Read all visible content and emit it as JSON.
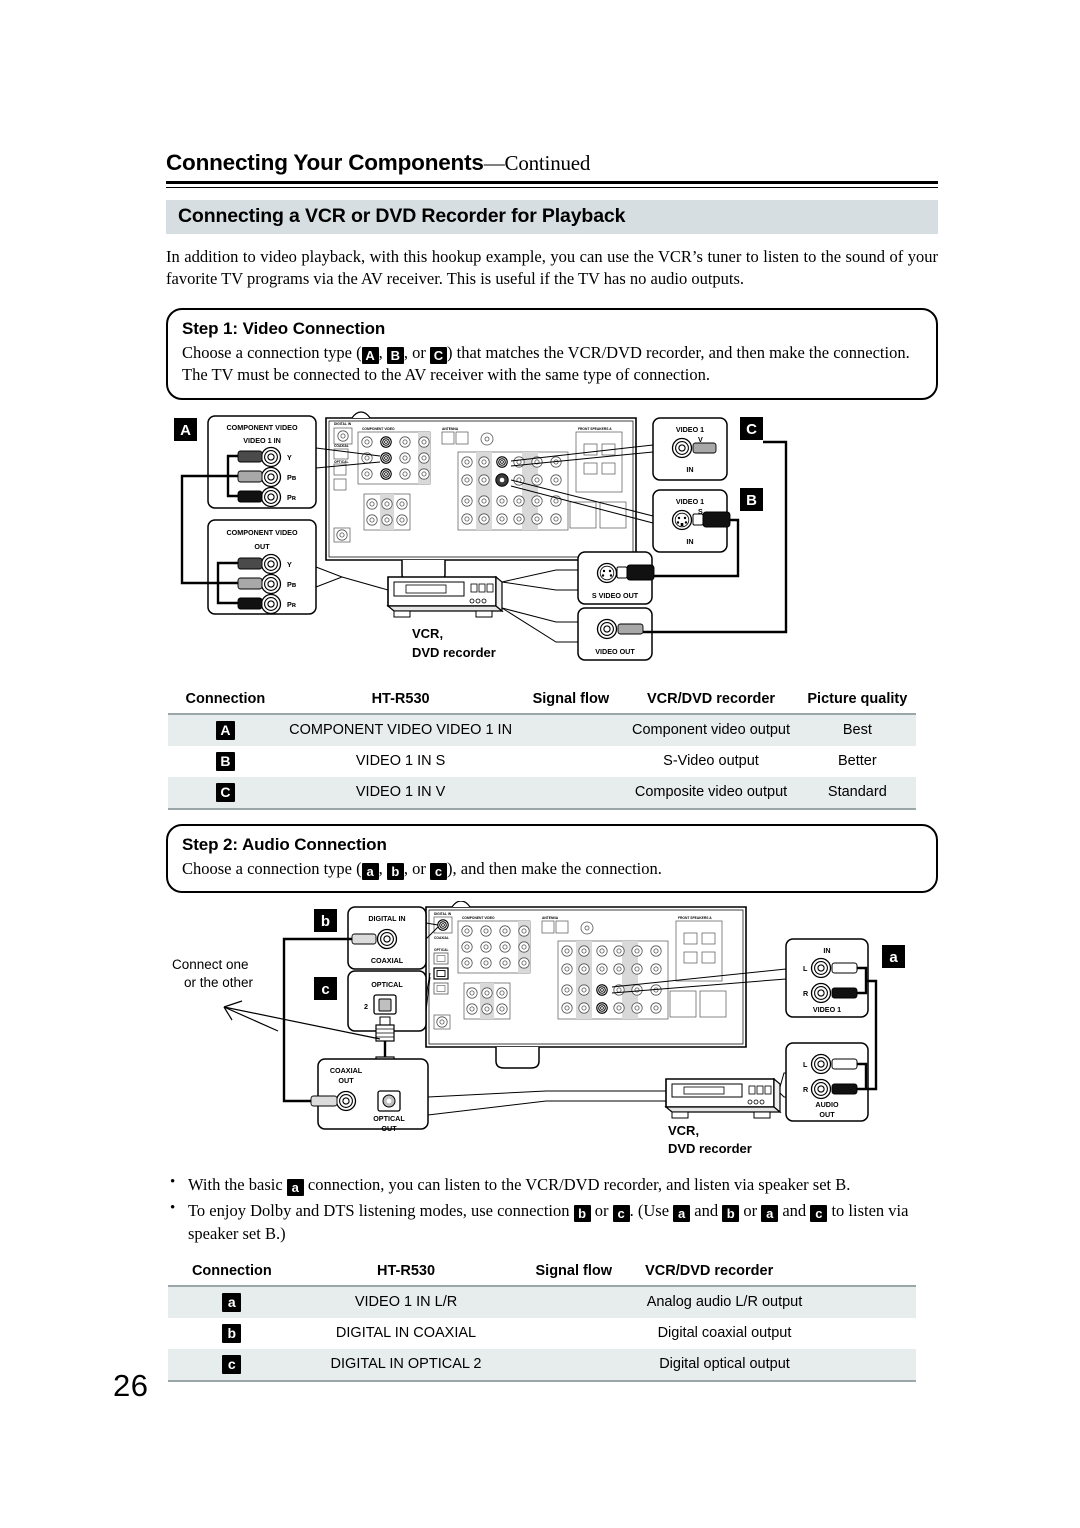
{
  "page": {
    "number": "26",
    "running_head": "Connecting Your Components",
    "running_head_suffix": "—Continued",
    "section_title": "Connecting a VCR or DVD Recorder for Playback",
    "intro": "In addition to video playback, with this hookup example, you can use the VCR’s tuner to listen to the sound of your favorite TV programs via the AV receiver. This is useful if the TV has no audio outputs."
  },
  "step1": {
    "title": "Step 1: Video Connection",
    "text_a": "Choose a connection type (",
    "badge_a": "A",
    "sep1": ", ",
    "badge_b": "B",
    "sep2": ", or ",
    "badge_c": "C",
    "text_b": ") that matches the VCR/DVD recorder, and then make the connection. The TV must be connected to the AV receiver with the same type of connection."
  },
  "step2": {
    "title": "Step 2: Audio Connection",
    "text_a": "Choose a connection type (",
    "badge_a": "a",
    "sep1": ", ",
    "badge_b": "b",
    "sep2": ", or ",
    "badge_c": "c",
    "text_b": "), and then make the connection."
  },
  "video_diagram": {
    "badge_a": "A",
    "badge_b": "B",
    "badge_c": "C",
    "receiver_component_panel": {
      "heading": "COMPONENT VIDEO",
      "sub": "VIDEO 1 IN",
      "jacks": [
        "Y",
        "Pʙ",
        "Pʀ"
      ]
    },
    "vcr_component_panel": {
      "heading": "COMPONENT VIDEO",
      "sub": "OUT",
      "jacks": [
        "Y",
        "Pʙ",
        "Pʀ"
      ]
    },
    "video1_v_panel": {
      "top": "VIDEO 1",
      "jack": "V",
      "bottom": "IN"
    },
    "video1_s_panel": {
      "top": "VIDEO 1",
      "jack": "S",
      "bottom": "IN"
    },
    "s_video_out_panel": {
      "label": "S VIDEO OUT"
    },
    "video_out_panel": {
      "label": "VIDEO OUT"
    },
    "device_label_line1": "VCR,",
    "device_label_line2": "DVD recorder",
    "receiver_panel_texts": {
      "component_video": "COMPONENT VIDEO",
      "antenna": "ANTENNA",
      "front_speakers": "FRONT SPEAKERS A"
    }
  },
  "audio_diagram": {
    "badge_a": "a",
    "badge_b": "b",
    "badge_c": "c",
    "connect_note_line1": "Connect one",
    "connect_note_line2": "or the other",
    "digital_in_panel": {
      "top": "DIGITAL IN",
      "bottom": "COAXIAL"
    },
    "optical_panel": {
      "top": "OPTICAL",
      "num": "2"
    },
    "coaxial_out_panel": {
      "line1": "COAXIAL",
      "line2": "OUT"
    },
    "optical_out_panel": {
      "line1": "OPTICAL",
      "line2": "OUT"
    },
    "video1_in_panel": {
      "top": "IN",
      "left": "L",
      "right": "R",
      "bottom": "VIDEO 1"
    },
    "audio_out_panel": {
      "left": "L",
      "right": "R",
      "line1": "AUDIO",
      "line2": "OUT"
    },
    "device_label_line1": "VCR,",
    "device_label_line2": "DVD recorder"
  },
  "video_table": {
    "headers": [
      "Connection",
      "HT-R530",
      "Signal flow",
      "VCR/DVD recorder",
      "Picture quality"
    ],
    "rows": [
      {
        "connection": "A",
        "receiver": "COMPONENT VIDEO VIDEO 1 IN",
        "flow": "",
        "recorder": "Component video output",
        "quality": "Best"
      },
      {
        "connection": "B",
        "receiver": "VIDEO 1 IN S",
        "flow": "",
        "recorder": "S-Video output",
        "quality": "Better"
      },
      {
        "connection": "C",
        "receiver": "VIDEO 1 IN V",
        "flow": "",
        "recorder": "Composite video output",
        "quality": "Standard"
      }
    ]
  },
  "audio_table": {
    "headers": [
      "Connection",
      "HT-R530",
      "Signal flow",
      "VCR/DVD recorder"
    ],
    "rows": [
      {
        "connection": "a",
        "receiver": "VIDEO 1 IN L/R",
        "flow": "",
        "recorder": "Analog audio L/R output"
      },
      {
        "connection": "b",
        "receiver": "DIGITAL IN COAXIAL",
        "flow": "",
        "recorder": "Digital coaxial output"
      },
      {
        "connection": "c",
        "receiver": "DIGITAL IN OPTICAL 2",
        "flow": "",
        "recorder": "Digital optical output"
      }
    ]
  },
  "notes": {
    "note1_a": "With the basic ",
    "note1_badge": "a",
    "note1_b": " connection, you can listen to the VCR/DVD recorder, and listen via speaker set B.",
    "note2_a": "To enjoy Dolby and DTS listening modes, use connection ",
    "note2_badge1": "b",
    "note2_mid1": " or ",
    "note2_badge2": "c",
    "note2_mid2": ". (Use ",
    "note2_badge3": "a",
    "note2_mid3": " and ",
    "note2_badge4": "b",
    "note2_mid4": " or ",
    "note2_badge5": "a",
    "note2_mid5": " and ",
    "note2_badge6": "c",
    "note2_end": " to listen via speaker set B.)"
  },
  "colors": {
    "band": "#d6dee1",
    "table_shade": "#e7ecec",
    "rule": "#9aa6a8"
  }
}
